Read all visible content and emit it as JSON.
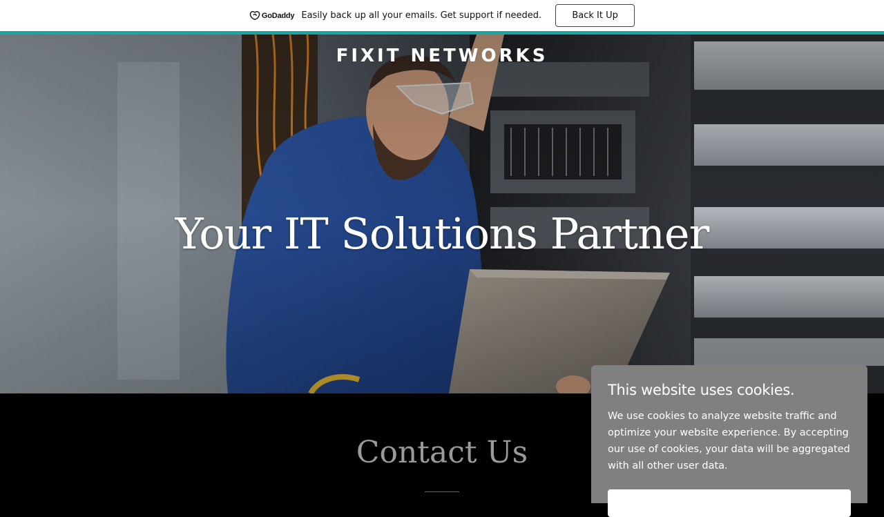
{
  "promo": {
    "brand": "GoDaddy",
    "message": "Easily back up all your emails. Get support if needed.",
    "button_label": "Back It Up",
    "accent_color": "#1ba5a7"
  },
  "hero": {
    "site_title": "FIXIT NETWORKS",
    "heading": "Your IT Solutions Partner",
    "image_subject": "technician-with-laptop-in-server-room"
  },
  "contact": {
    "title": "Contact Us"
  },
  "cookie": {
    "title": "This website uses cookies.",
    "body": "We use cookies to analyze website traffic and optimize your website experience. By accepting our use of cookies, your data will be aggregated with all other user data.",
    "background_color": "#808080"
  }
}
